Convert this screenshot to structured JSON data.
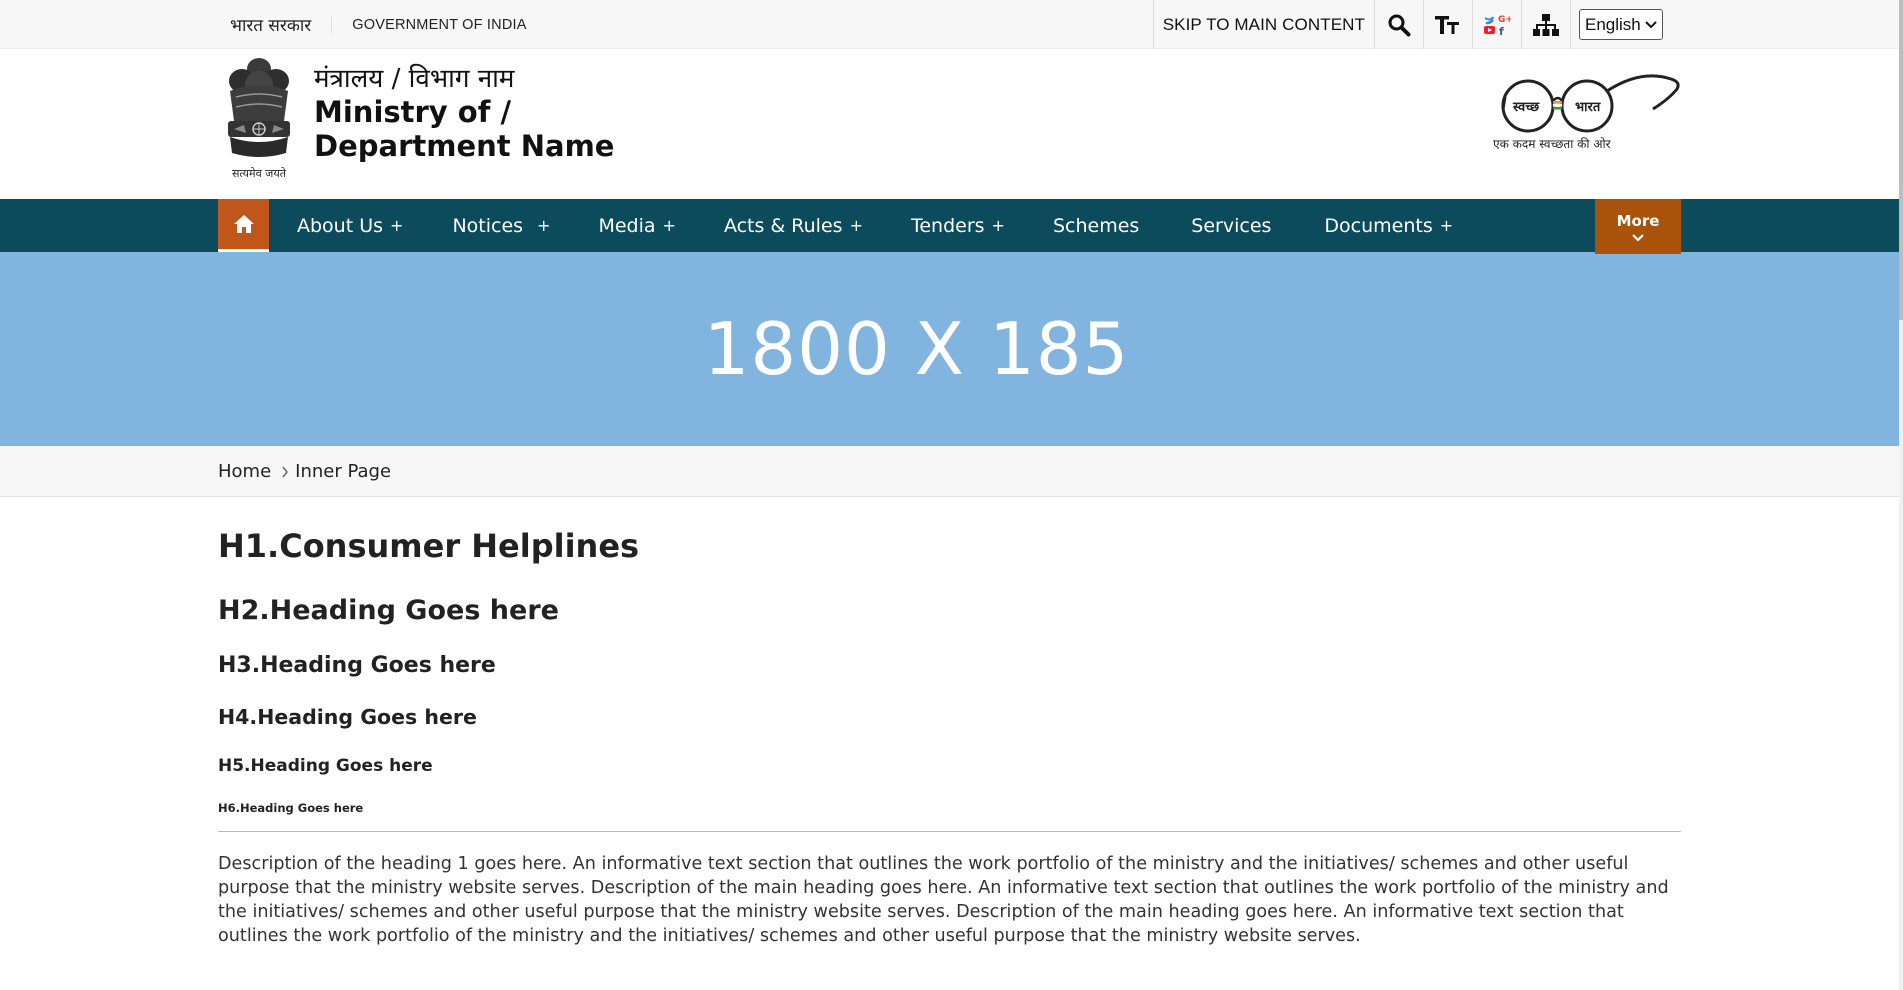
{
  "topbar": {
    "hindi_label": "भारत सरकार",
    "gov_label": "GOVERNMENT OF INDIA",
    "skip_label": "SKIP TO MAIN CONTENT",
    "icons": [
      "search-icon",
      "text-size-icon",
      "social-media-icon",
      "sitemap-icon"
    ],
    "language": "English"
  },
  "header": {
    "emblem_caption": "सत्यमेव जयते",
    "ministry_hindi": "मंत्रालय / विभाग नाम",
    "ministry_en_line1": "Ministry of /",
    "ministry_en_line2": "Department Name",
    "swachh_left": "स्वच्छ",
    "swachh_right": "भारत",
    "swachh_caption": "एक कदम स्वच्छता की ओर"
  },
  "nav": {
    "items": [
      {
        "label": "About Us",
        "has_submenu": true
      },
      {
        "label": "Notices",
        "has_submenu": true
      },
      {
        "label": "Media",
        "has_submenu": true
      },
      {
        "label": "Acts & Rules",
        "has_submenu": true
      },
      {
        "label": "Tenders",
        "has_submenu": true
      },
      {
        "label": "Schemes",
        "has_submenu": false
      },
      {
        "label": "Services",
        "has_submenu": false
      },
      {
        "label": "Documents",
        "has_submenu": true
      }
    ],
    "plus": "+",
    "more_label": "More",
    "colors": {
      "bar": "#0b4b5c",
      "home": "#c0561a",
      "more": "#a9530c"
    }
  },
  "banner": {
    "text": "1800 X 185",
    "color": "#81b5df"
  },
  "breadcrumb": {
    "home": "Home",
    "current": "Inner Page"
  },
  "content": {
    "h1": "H1.Consumer Helplines",
    "h2": "H2.Heading Goes here",
    "h3": "H3.Heading Goes here",
    "h4": "H4.Heading Goes here",
    "h5": "H5.Heading Goes here",
    "h6": "H6.Heading Goes here",
    "paragraph": "Description of the heading 1 goes here. An informative text section that outlines the work portfolio of the ministry and the initiatives/ schemes and other useful purpose that the ministry website serves. Description of the main heading goes here. An informative text section that outlines the work portfolio of the ministry and the initiatives/ schemes and other useful purpose that the ministry website serves. Description of the main heading goes here. An informative text section that outlines the work portfolio of the ministry and the initiatives/ schemes and other useful purpose that the ministry website serves."
  }
}
